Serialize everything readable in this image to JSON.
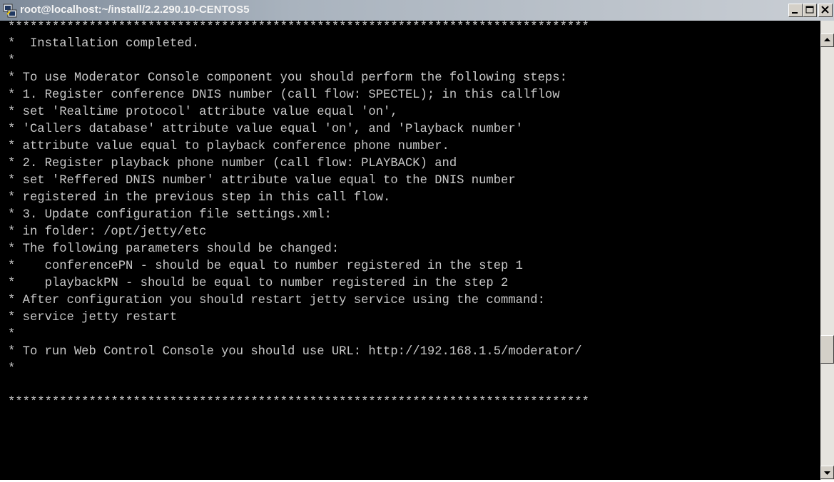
{
  "window": {
    "title": "root@localhost:~/install/2.2.290.10-CENTOS5",
    "icon": "putty-icon",
    "controls": [
      "minimize-icon",
      "maximize-icon",
      "close-icon"
    ]
  },
  "terminal": {
    "lines": [
      "*******************************************************************************",
      "*  Installation completed.",
      "*",
      "* To use Moderator Console component you should perform the following steps:",
      "* 1. Register conference DNIS number (call flow: SPECTEL); in this callflow",
      "* set 'Realtime protocol' attribute value equal 'on',",
      "* 'Callers database' attribute value equal 'on', and 'Playback number'",
      "* attribute value equal to playback conference phone number.",
      "* 2. Register playback phone number (call flow: PLAYBACK) and",
      "* set 'Reffered DNIS number' attribute value equal to the DNIS number",
      "* registered in the previous step in this call flow.",
      "* 3. Update configuration file settings.xml:",
      "* in folder: /opt/jetty/etc",
      "* The following parameters should be changed:",
      "*    conferencePN - should be equal to number registered in the step 1",
      "*    playbackPN - should be equal to number registered in the step 2",
      "* After configuration you should restart jetty service using the command:",
      "* service jetty restart",
      "*",
      "* To run Web Control Console you should use URL: http://192.168.1.5/moderator/",
      "*",
      "",
      "*******************************************************************************"
    ]
  },
  "scrollbar": {
    "up_icon": "arrow-up-icon",
    "down_icon": "arrow-down-icon"
  }
}
